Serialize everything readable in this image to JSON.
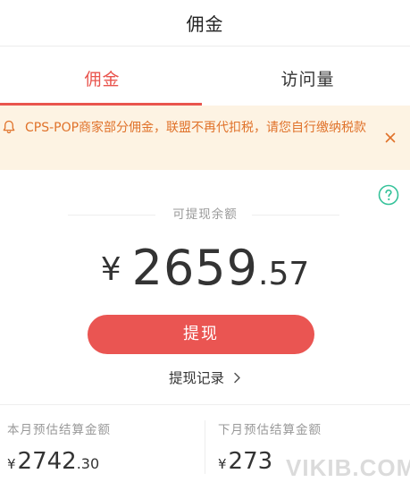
{
  "header": {
    "title": "佣金"
  },
  "tabs": [
    {
      "label": "佣金",
      "active": true
    },
    {
      "label": "访问量",
      "active": false
    }
  ],
  "notice": {
    "text": "CPS-POP商家部分佣金，联盟不再代扣税，请您自行缴纳税款",
    "icon": "bell-icon",
    "close_icon": "close-icon"
  },
  "balance": {
    "caption": "可提现余额",
    "currency": "¥",
    "integer": "2659",
    "decimal": ".57",
    "help_icon": "question-circle-icon"
  },
  "actions": {
    "withdraw_label": "提现",
    "records_label": "提现记录",
    "records_icon": "chevron-right-icon"
  },
  "estimates": {
    "this_month": {
      "label": "本月预估结算金额",
      "currency": "¥",
      "integer": "2742",
      "decimal": ".30"
    },
    "next_month": {
      "label": "下月预估结算金额",
      "currency": "¥",
      "integer": "273"
    }
  },
  "watermark": "VIKIB.COM",
  "colors": {
    "accent": "#e9554e",
    "notice_bg": "#fdf3e3",
    "notice_text": "#e0722a",
    "help_icon": "#35c29a"
  }
}
